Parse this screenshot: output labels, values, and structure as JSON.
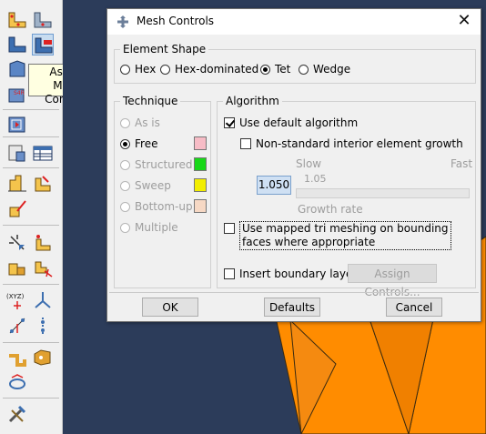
{
  "tooltip": {
    "line1": "Assign",
    "line2": "Mesh Controls"
  },
  "dialog": {
    "title": "Mesh Controls",
    "element_shape": {
      "legend": "Element Shape",
      "options": [
        "Hex",
        "Hex-dominated",
        "Tet",
        "Wedge"
      ],
      "selected": "Tet"
    },
    "technique": {
      "legend": "Technique",
      "options": [
        {
          "label": "As is",
          "enabled": false,
          "color": ""
        },
        {
          "label": "Free",
          "enabled": true,
          "selected": true,
          "color": "#f7bcc6"
        },
        {
          "label": "Structured",
          "enabled": false,
          "color": "#18d818"
        },
        {
          "label": "Sweep",
          "enabled": false,
          "color": "#f2ee00"
        },
        {
          "label": "Bottom-up",
          "enabled": false,
          "color": "#f6d8c4"
        },
        {
          "label": "Multiple",
          "enabled": false,
          "color": ""
        }
      ]
    },
    "algorithm": {
      "legend": "Algorithm",
      "use_default": "Use default algorithm",
      "use_default_checked": true,
      "non_standard": "Non-standard interior element growth",
      "non_standard_checked": false,
      "slow": "Slow",
      "fast": "Fast",
      "slider_value": "1.05",
      "growth_value": "1.050",
      "growth_rate": "Growth rate",
      "mapped_line1": "Use mapped tri meshing on bounding",
      "mapped_line2": "faces where appropriate",
      "mapped_checked": false,
      "boundary_layer": "Insert boundary layer",
      "boundary_layer_checked": false,
      "assign_controls": "Assign Controls..."
    },
    "buttons": {
      "ok": "OK",
      "defaults": "Defaults",
      "cancel": "Cancel"
    }
  },
  "colors": {
    "viewport": "#2c3c5a",
    "mesh": "#ff8c00",
    "mesh_edge": "#3a2a10"
  },
  "toolbar_icons": [
    "seed-part-icon",
    "seed-edges-icon",
    "delete-seeds-icon",
    "assign-mesh-controls-icon",
    "assign-element-type-icon",
    "mesh-part-icon",
    "delete-mesh-icon",
    "verify-mesh-icon",
    "query-mesh-icon",
    "mesh-table-icon",
    "edit-mesh-icon",
    "partition-edge-icon",
    "partition-face-icon",
    "virtual-topology-icon",
    "select-node-icon",
    "edit-node-icon",
    "part-feature-icon",
    "create-datum-icon",
    "datum-axis-icon",
    "datum-plane-icon",
    "datum-csys-icon",
    "query-icon",
    "cut-icon",
    "create-set-icon",
    "tools-icon"
  ]
}
